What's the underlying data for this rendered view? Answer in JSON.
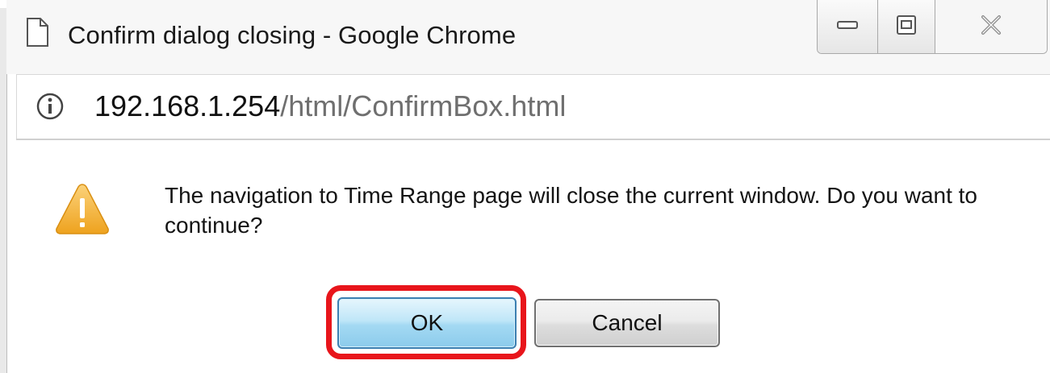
{
  "window": {
    "title": "Confirm dialog closing - Google Chrome"
  },
  "address_bar": {
    "url_host": "192.168.1.254",
    "url_path": "/html/ConfirmBox.html",
    "info_icon": "info-icon"
  },
  "dialog": {
    "icon": "warning-icon",
    "message": "The navigation to Time Range page will close the current window. Do you want to continue?",
    "ok_label": "OK",
    "cancel_label": "Cancel"
  },
  "colors": {
    "highlight": "#e8151b",
    "warning": "#f5b33f",
    "ok_button": "#a3d9f3"
  }
}
